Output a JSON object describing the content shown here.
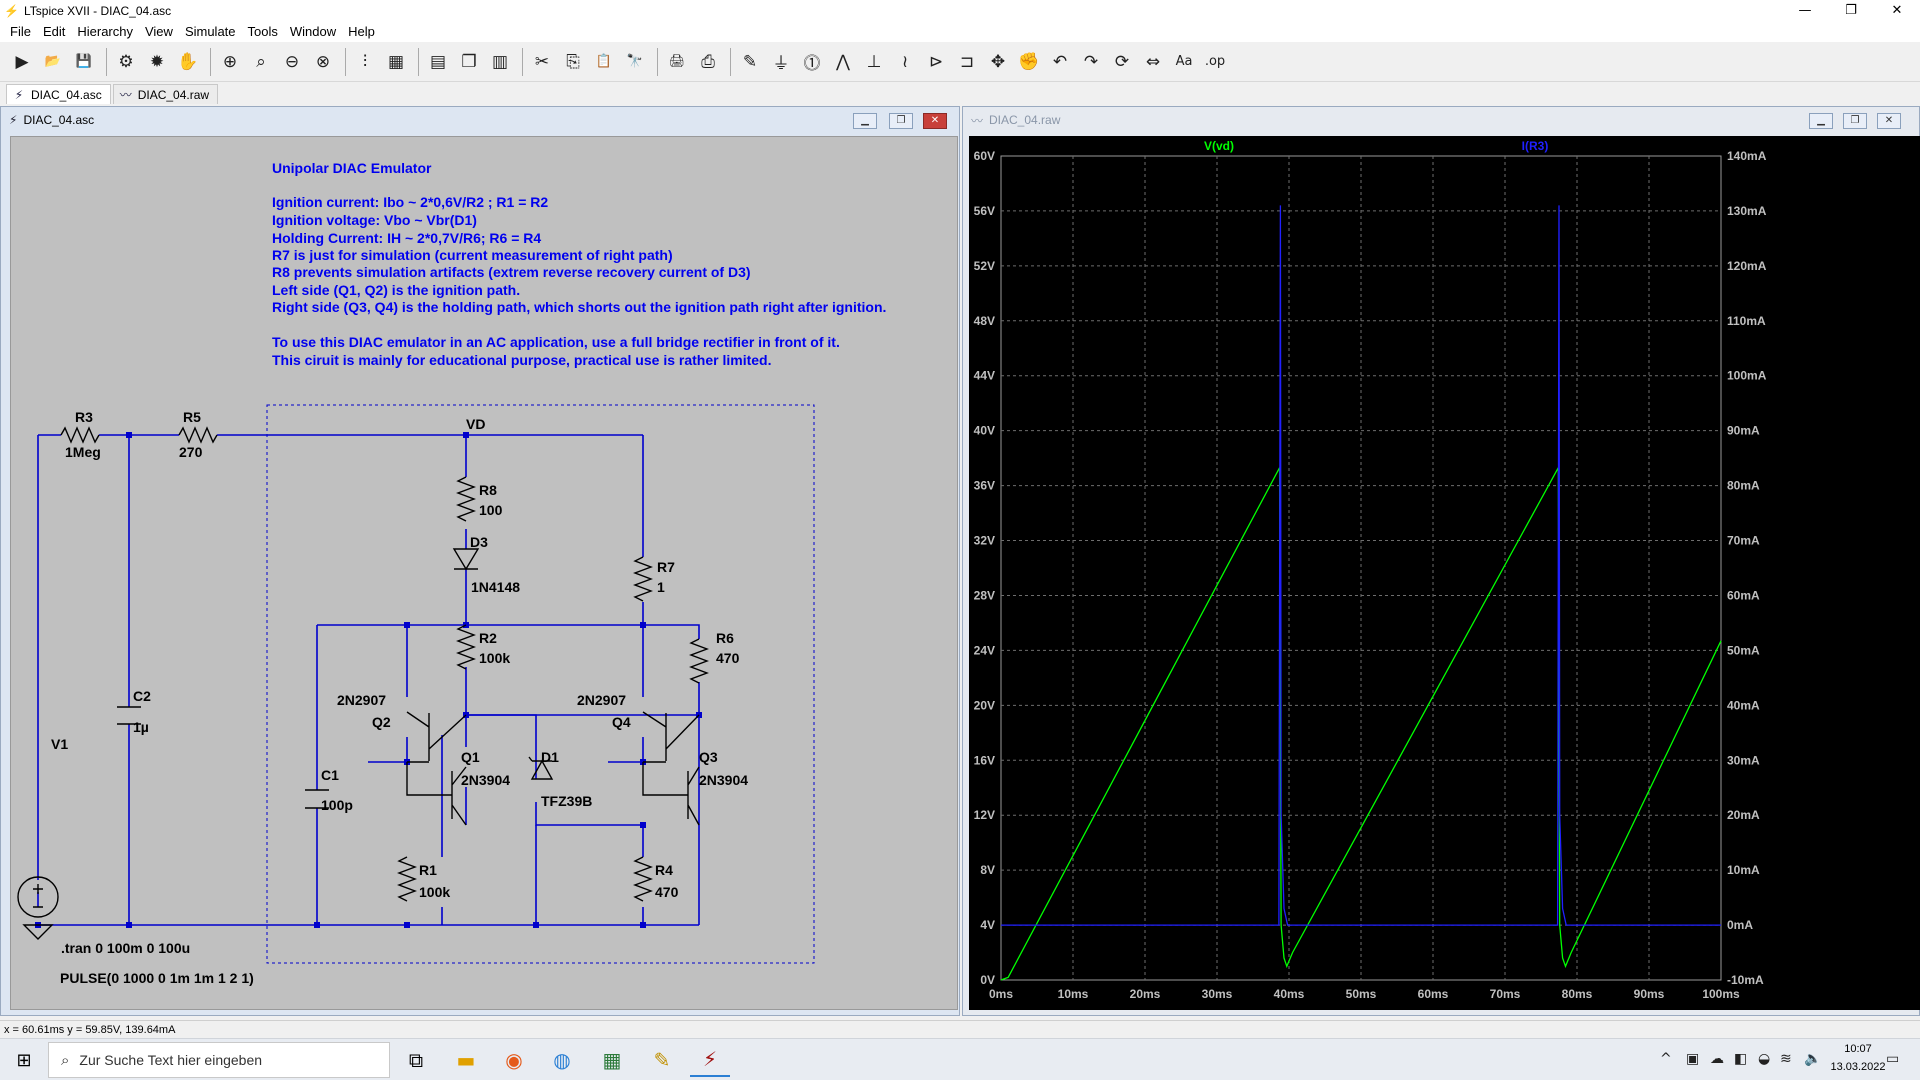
{
  "window": {
    "title": "LTspice XVII - DIAC_04.asc",
    "minimize": "—",
    "maximize": "❐",
    "close": "✕"
  },
  "menu": [
    "File",
    "Edit",
    "Hierarchy",
    "View",
    "Simulate",
    "Tools",
    "Window",
    "Help"
  ],
  "toolbar": {
    "icons": [
      "run-icon",
      "open-icon",
      "save-icon",
      "control-panel-icon",
      "halt-icon",
      "pan-hand-icon",
      "zoom-in-icon",
      "zoom-full-icon",
      "zoom-out-icon",
      "zoom-cancel-icon",
      "autorange-icon",
      "grid-icon",
      "tile-horizontal-icon",
      "cascade-icon",
      "tile-vertical-icon",
      "cut-icon",
      "copy-icon",
      "paste-icon",
      "find-icon",
      "print-icon",
      "print-preview-icon",
      "draw-wire-icon",
      "ground-icon",
      "label-net-icon",
      "resistor-icon",
      "capacitor-icon",
      "inductor-icon",
      "diode-icon",
      "component-icon",
      "move-icon",
      "drag-icon",
      "undo-icon",
      "redo-icon",
      "rotate-icon",
      "mirror-icon",
      "text-icon",
      "spice-directive-icon"
    ],
    "glyphs": [
      "▶",
      "📂",
      "💾",
      "⚙",
      "✹",
      "✋",
      "⊕",
      "⌕",
      "⊖",
      "⊗",
      "⫶",
      "▦",
      "▤",
      "❐",
      "▥",
      "✂",
      "⎘",
      "📋",
      "🔭",
      "🖨",
      "⎙",
      "✎",
      "⏚",
      "⓵",
      "⋀",
      "⊥",
      "≀",
      "⊳",
      "⊐",
      "✥",
      "✊",
      "↶",
      "↷",
      "⟳",
      "⇔",
      "Aa",
      ".op"
    ]
  },
  "tabs": [
    {
      "label": "DIAC_04.asc",
      "icon": "schematic-icon",
      "active": true
    },
    {
      "label": "DIAC_04.raw",
      "icon": "waveform-icon",
      "active": false
    }
  ],
  "schematic_window": {
    "title": "DIAC_04.asc"
  },
  "waveform_window": {
    "title": "DIAC_04.raw"
  },
  "schematic": {
    "comment_title": "Unipolar DIAC Emulator",
    "comment_lines": [
      "Ignition current: Ibo ~ 2*0,6V/R2  ; R1 = R2",
      "Ignition voltage: Vbo ~ Vbr(D1)",
      "Holding Current: IH ~ 2*0,7V/R6; R6 = R4",
      "R7 is just for simulation (current measurement of right path)",
      "R8 prevents simulation artifacts (extrem reverse recovery current of D3)",
      "Left side (Q1, Q2) is the ignition path.",
      "Right side (Q3, Q4) is the holding path, which shorts out the ignition path right after ignition.",
      "",
      "To use this DIAC emulator in an AC application, use a full bridge rectifier in front of it.",
      "This ciruit is mainly for educational purpose, practical use is rather limited."
    ],
    "net_label": "VD",
    "components": {
      "R3": {
        "name": "R3",
        "value": "1Meg"
      },
      "R5": {
        "name": "R5",
        "value": "270"
      },
      "R8": {
        "name": "R8",
        "value": "100"
      },
      "D3": {
        "name": "D3",
        "value": "1N4148"
      },
      "R7": {
        "name": "R7",
        "value": "1"
      },
      "R2": {
        "name": "R2",
        "value": "100k"
      },
      "R6": {
        "name": "R6",
        "value": "470"
      },
      "C2": {
        "name": "C2",
        "value": "1µ"
      },
      "V1": {
        "name": "V1"
      },
      "Q2": {
        "name": "Q2",
        "value": "2N2907"
      },
      "Q4": {
        "name": "Q4",
        "value": "2N2907"
      },
      "Q1": {
        "name": "Q1",
        "value": "2N3904"
      },
      "Q3": {
        "name": "Q3",
        "value": "2N3904"
      },
      "D1": {
        "name": "D1",
        "value": "TFZ39B"
      },
      "C1": {
        "name": "C1",
        "value": "100p"
      },
      "R1": {
        "name": "R1",
        "value": "100k"
      },
      "R4": {
        "name": "R4",
        "value": "470"
      }
    },
    "directives": [
      ".tran 0 100m 0 100u",
      "PULSE(0 1000 0 1m 1m 1 2 1)"
    ]
  },
  "chart_data": {
    "type": "line",
    "x_ticks": [
      "0ms",
      "10ms",
      "20ms",
      "30ms",
      "40ms",
      "50ms",
      "60ms",
      "70ms",
      "80ms",
      "90ms",
      "100ms"
    ],
    "xlim": [
      0,
      100
    ],
    "left_ticks": [
      "0V",
      "4V",
      "8V",
      "12V",
      "16V",
      "20V",
      "24V",
      "28V",
      "32V",
      "36V",
      "40V",
      "44V",
      "48V",
      "52V",
      "56V",
      "60V"
    ],
    "ylim_left": [
      0,
      60
    ],
    "right_ticks": [
      "-10mA",
      "0mA",
      "10mA",
      "20mA",
      "30mA",
      "40mA",
      "50mA",
      "60mA",
      "70mA",
      "80mA",
      "90mA",
      "100mA",
      "110mA",
      "120mA",
      "130mA",
      "140mA"
    ],
    "ylim_right": [
      -10,
      140
    ],
    "grid": true,
    "series": [
      {
        "name": "V(vd)",
        "axis": "left",
        "color": "#00ff00",
        "x": [
          0,
          1,
          38.7,
          38.9,
          39.3,
          39.7,
          40.5,
          77.4,
          77.6,
          78.0,
          78.4,
          79.2,
          100
        ],
        "y": [
          0,
          0.2,
          37.3,
          4.0,
          1.6,
          1.0,
          2.0,
          37.3,
          4.0,
          1.6,
          1.0,
          2.0,
          24.7
        ]
      },
      {
        "name": "I(R3)",
        "axis": "right",
        "color": "#2020ff",
        "x": [
          0,
          38.6,
          38.8,
          38.9,
          39.3,
          39.8,
          40.0,
          77.3,
          77.5,
          77.6,
          78.0,
          78.5,
          78.7,
          100
        ],
        "y": [
          0,
          0,
          131,
          20,
          3,
          0,
          0,
          0,
          131,
          20,
          3,
          0,
          0,
          0
        ]
      }
    ]
  },
  "status": {
    "cursor": "x = 60.61ms    y = 59.85V, 139.64mA"
  },
  "taskbar": {
    "search_placeholder": "Zur Suche Text hier eingeben",
    "time": "10:07",
    "date": "13.03.2022",
    "apps": [
      "task-view-icon",
      "file-explorer-icon",
      "firefox-icon",
      "app-icon",
      "calculator-icon",
      "pen-app-icon",
      "ltspice-icon"
    ]
  }
}
